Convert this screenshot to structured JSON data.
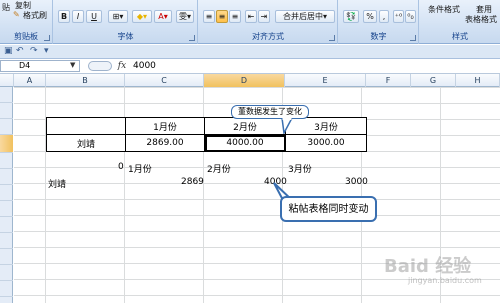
{
  "ribbon": {
    "clipboard": {
      "title": "剪贴板",
      "copy": "复制",
      "format_painter": "格式刷",
      "paste_icon": "paste-icon"
    },
    "font": {
      "title": "字体",
      "bold": "B",
      "italic": "I",
      "underline": "U"
    },
    "alignment": {
      "title": "对齐方式",
      "merge_center": "合并后居中"
    },
    "number": {
      "title": "数字",
      "percent": "%",
      "comma": ","
    },
    "styles": {
      "title": "样式",
      "conditional_format": "条件格式",
      "table_format_1": "套用",
      "table_format_2": "表格格式"
    }
  },
  "formula_bar": {
    "name_box": "D4",
    "fx": "fx",
    "value": "4000"
  },
  "columns": [
    "A",
    "B",
    "C",
    "D",
    "E",
    "F",
    "G",
    "H"
  ],
  "active_column": "D",
  "table1": {
    "headers": [
      "",
      "1月份",
      "2月份",
      "3月份"
    ],
    "row": [
      "刘靖",
      "2869.00",
      "4000.00",
      "3000.00"
    ]
  },
  "table2": {
    "headers": [
      "0",
      "1月份",
      "2月份",
      "3月份"
    ],
    "row": [
      "刘靖",
      "2869",
      "4000",
      "3000"
    ]
  },
  "callouts": {
    "top": "董数据发生了变化",
    "bottom": "粘帖表格同时变动"
  },
  "watermark": {
    "main": "Baid 经验",
    "sub": "jingyan.baidu.com"
  }
}
